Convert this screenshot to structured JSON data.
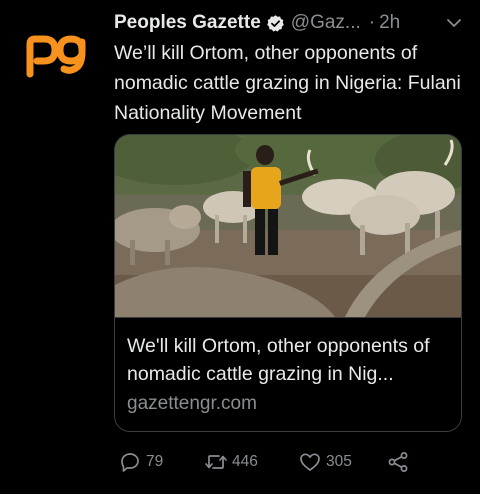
{
  "tweet": {
    "display_name": "Peoples Gazette",
    "handle": "@Gaz...",
    "separator": "·",
    "timestamp": "2h",
    "avatar_icon": "peoples-gazette-logo",
    "text": "We’ll kill Ortom, other opponents of nomadic cattle grazing in Nigeria: Fulani Nationality Movement"
  },
  "card": {
    "title": "We'll kill Ortom, other opponents of nomadic cattle grazing in Nig...",
    "domain": "gazettengr.com"
  },
  "actions": {
    "reply_count": "79",
    "retweet_count": "446",
    "like_count": "305"
  },
  "colors": {
    "background": "#000000",
    "text": "#e7e9ea",
    "muted": "#8a8d91",
    "brand_orange": "#f7921e",
    "border": "#3a3d41"
  }
}
